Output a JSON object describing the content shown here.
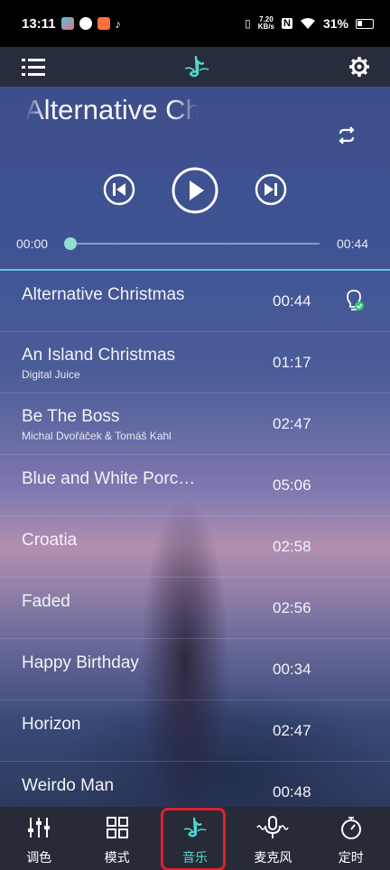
{
  "status_bar": {
    "time": "13:11",
    "net_speed_value": "7.20",
    "net_speed_unit": "KB/s",
    "battery": "31%"
  },
  "app_bar": {
    "menu_icon": "menu-icon",
    "logo_icon": "music-note-icon",
    "settings_icon": "gear-icon"
  },
  "player": {
    "now_playing_title": "Alternative Christmas",
    "elapsed": "00:00",
    "duration": "00:44",
    "progress": 0.0
  },
  "songs": [
    {
      "title": "Alternative Christmas",
      "artist": "",
      "duration": "00:44",
      "playing": true
    },
    {
      "title": "An Island Christmas",
      "artist": "Digital Juice",
      "duration": "01:17"
    },
    {
      "title": "Be The Boss",
      "artist": "Michal Dvořáček & Tomáš Kahl",
      "duration": "02:47"
    },
    {
      "title": "Blue and White Porc…",
      "artist": "",
      "duration": "05:06"
    },
    {
      "title": "Croatia",
      "artist": "",
      "duration": "02:58"
    },
    {
      "title": "Faded",
      "artist": "",
      "duration": "02:56"
    },
    {
      "title": "Happy Birthday",
      "artist": "",
      "duration": "00:34"
    },
    {
      "title": "Horizon",
      "artist": "",
      "duration": "02:47"
    },
    {
      "title": "Weirdo Man",
      "artist": "",
      "duration": "00:48"
    }
  ],
  "bottom_nav": [
    {
      "label": "调色",
      "icon": "sliders-icon"
    },
    {
      "label": "模式",
      "icon": "grid-icon"
    },
    {
      "label": "音乐",
      "icon": "music-note-icon",
      "active": true
    },
    {
      "label": "麦克风",
      "icon": "microphone-icon"
    },
    {
      "label": "定时",
      "icon": "timer-icon"
    }
  ],
  "colors": {
    "accent": "#52d6d0",
    "active_highlight": "#e4202a",
    "bar_bg": "#262b37"
  }
}
